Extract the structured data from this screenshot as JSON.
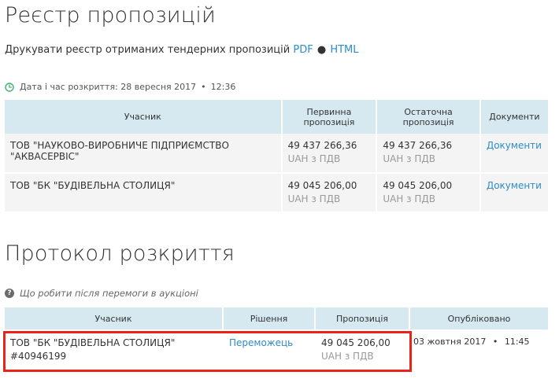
{
  "registry": {
    "title": "Реєстр пропозицій",
    "print_text": "Друкувати реєстр отриманих тендерних пропозицій",
    "pdf_link": "PDF",
    "separator": "●",
    "html_link": "HTML",
    "opening_date_label": "Дата і час розкриття: 28 вересня 2017",
    "opening_time": "12:36",
    "columns": [
      "Учасник",
      "Первинна пропозиція",
      "Остаточна пропозиція",
      "Документи"
    ],
    "rows": [
      {
        "participant": "ТОВ \"НАУКОВО-ВИРОБНИЧЕ ПІДПРИЄМСТВО \"АКВАСЕРВІС\"",
        "initial_amount": "49 437 266,36",
        "initial_currency": "UAH з ПДВ",
        "final_amount": "49 437 266,36",
        "final_currency": "UAH з ПДВ",
        "documents_link": "Документи"
      },
      {
        "participant": "ТОВ \"БК \"БУДІВЕЛЬНА СТОЛИЦЯ\"",
        "initial_amount": "49 045 206,00",
        "initial_currency": "UAH з ПДВ",
        "final_amount": "49 045 206,00",
        "final_currency": "UAH з ПДВ",
        "documents_link": "Документи"
      }
    ]
  },
  "protocol": {
    "title": "Протокол розкриття",
    "help_text": "Що робити після перемоги в аукціоні",
    "columns": [
      "Учасник",
      "Рішення",
      "Пропозиція",
      "Опубліковано"
    ],
    "rows": [
      {
        "participant_name": "ТОВ \"БК \"БУДІВЕЛЬНА СТОЛИЦЯ\"",
        "participant_code": "#40946199",
        "decision": "Переможець",
        "amount": "49 045 206,00",
        "currency": "UAH з ПДВ",
        "published_date": "03 жовтня 2017",
        "published_time": "11:45"
      }
    ]
  },
  "colors": {
    "header_bg": "#d6e9f1",
    "row_bg": "#f4f4f4",
    "link": "#2c8dc9",
    "highlight_border": "#e8231a",
    "clock_icon": "#3cb371"
  }
}
